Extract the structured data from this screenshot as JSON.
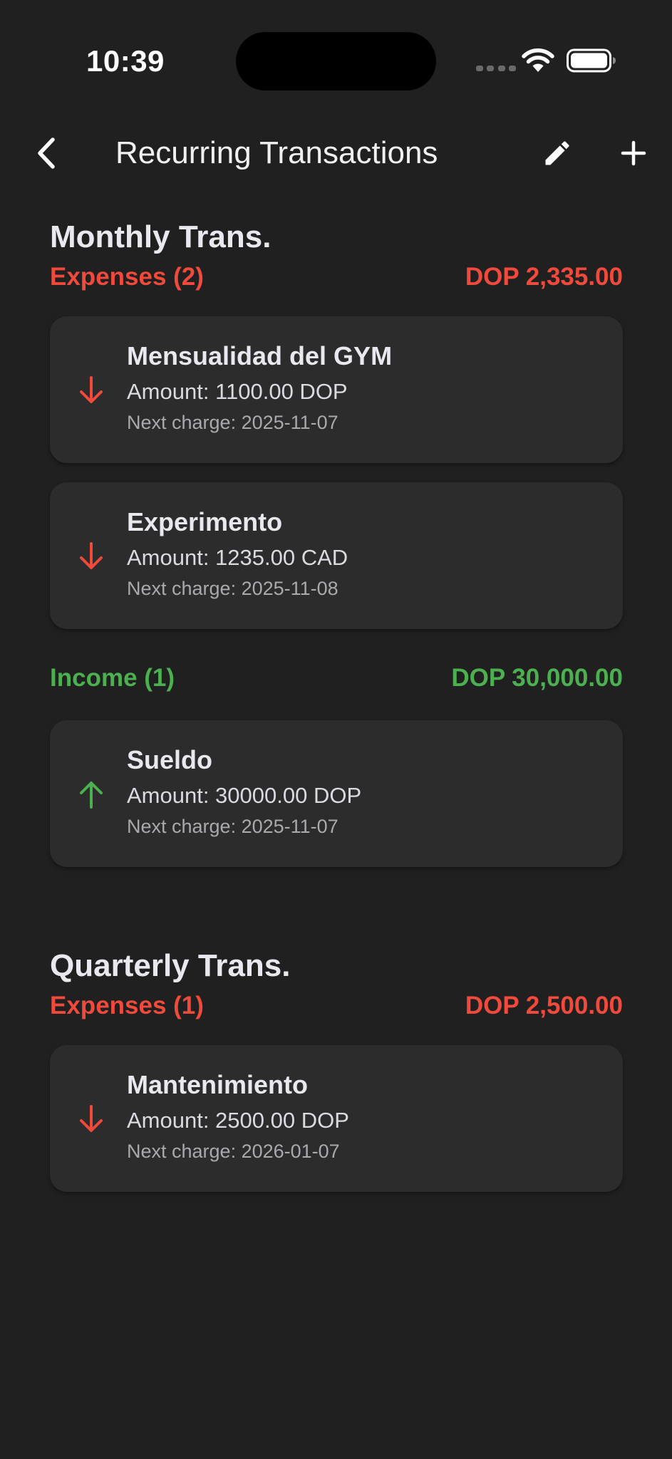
{
  "status_bar": {
    "time": "10:39"
  },
  "nav": {
    "title": "Recurring Transactions",
    "back_icon": "chevron-left-icon",
    "edit_icon": "pencil-icon",
    "add_icon": "plus-icon"
  },
  "colors": {
    "background": "#202020",
    "card": "#2C2C2C",
    "expense": "#EF4A3C",
    "income": "#4CAF50"
  },
  "sections": [
    {
      "title": "Monthly Trans.",
      "groups": [
        {
          "type": "expense",
          "label": "Expenses (2)",
          "total": "DOP 2,335.00",
          "items": [
            {
              "name": "Mensualidad del GYM",
              "amount": "Amount: 1100.00 DOP",
              "next": "Next charge: 2025-11-07"
            },
            {
              "name": "Experimento",
              "amount": "Amount: 1235.00 CAD",
              "next": "Next charge: 2025-11-08"
            }
          ]
        },
        {
          "type": "income",
          "label": "Income (1)",
          "total": "DOP 30,000.00",
          "items": [
            {
              "name": "Sueldo",
              "amount": "Amount: 30000.00 DOP",
              "next": "Next charge: 2025-11-07"
            }
          ]
        }
      ]
    },
    {
      "title": "Quarterly Trans.",
      "groups": [
        {
          "type": "expense",
          "label": "Expenses (1)",
          "total": "DOP 2,500.00",
          "items": [
            {
              "name": "Mantenimiento",
              "amount": "Amount: 2500.00 DOP",
              "next": "Next charge: 2026-01-07"
            }
          ]
        }
      ]
    }
  ]
}
